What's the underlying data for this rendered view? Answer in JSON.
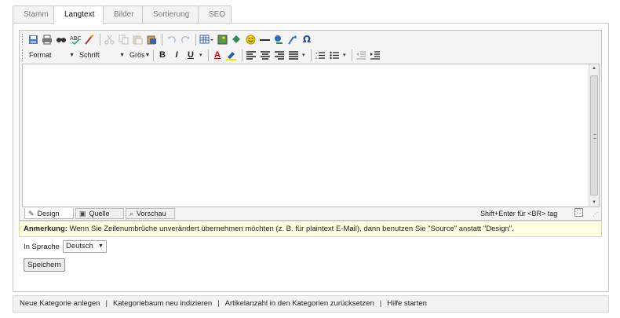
{
  "tabs": [
    {
      "label": "Stamm"
    },
    {
      "label": "Langtext"
    },
    {
      "label": "Bilder"
    },
    {
      "label": "Sortierung"
    },
    {
      "label": "SEO"
    }
  ],
  "active_tab": "Langtext",
  "toolbar": {
    "format_label": "Format",
    "font_label": "Schrift",
    "size_label": "Grös",
    "bold": "B",
    "italic": "I",
    "underline": "U",
    "font_color": "A",
    "special_char": "Ω",
    "icons_row1": [
      "save-icon",
      "print-icon",
      "find-icon",
      "spellcheck-icon",
      "clean-icon",
      "cut-icon",
      "copy-icon",
      "paste-text-icon",
      "paste-word-icon",
      "undo-icon",
      "redo-icon",
      "table-icon",
      "image-icon",
      "anchor-icon",
      "smiley-icon",
      "horizontal-rule-icon",
      "link-icon",
      "unlink-icon",
      "special-char-icon"
    ],
    "icons_row2": [
      "bold-icon",
      "italic-icon",
      "underline-icon",
      "font-color-icon",
      "highlight-icon",
      "align-left-icon",
      "align-center-icon",
      "align-right-icon",
      "justify-icon",
      "ordered-list-icon",
      "unordered-list-icon",
      "outdent-icon",
      "indent-icon"
    ]
  },
  "modes": {
    "design": "Design",
    "source": "Quelle",
    "preview": "Vorschau"
  },
  "hint": "Shift+Enter für <BR> tag",
  "note": {
    "label": "Anmerkung:",
    "text": "Wenn Sie Zeilenumbrüche unverändert übernehmen möchten (z. B. für plaintext E-Mail), dann benutzen Sie \"Source\" anstatt \"Design\"."
  },
  "language": {
    "label": "In Sprache",
    "selected": "Deutsch"
  },
  "save_label": "Speichern",
  "footer_links": [
    {
      "label": "Neue Kategorie anlegen"
    },
    {
      "label": "Kategoriebaum neu indizieren"
    },
    {
      "label": "Artikelanzahl in den Kategorien zurücksetzen"
    },
    {
      "label": "Hilfe starten"
    }
  ],
  "colors": {
    "accent_red": "#cc0000",
    "note_bg": "#ffffe6"
  }
}
